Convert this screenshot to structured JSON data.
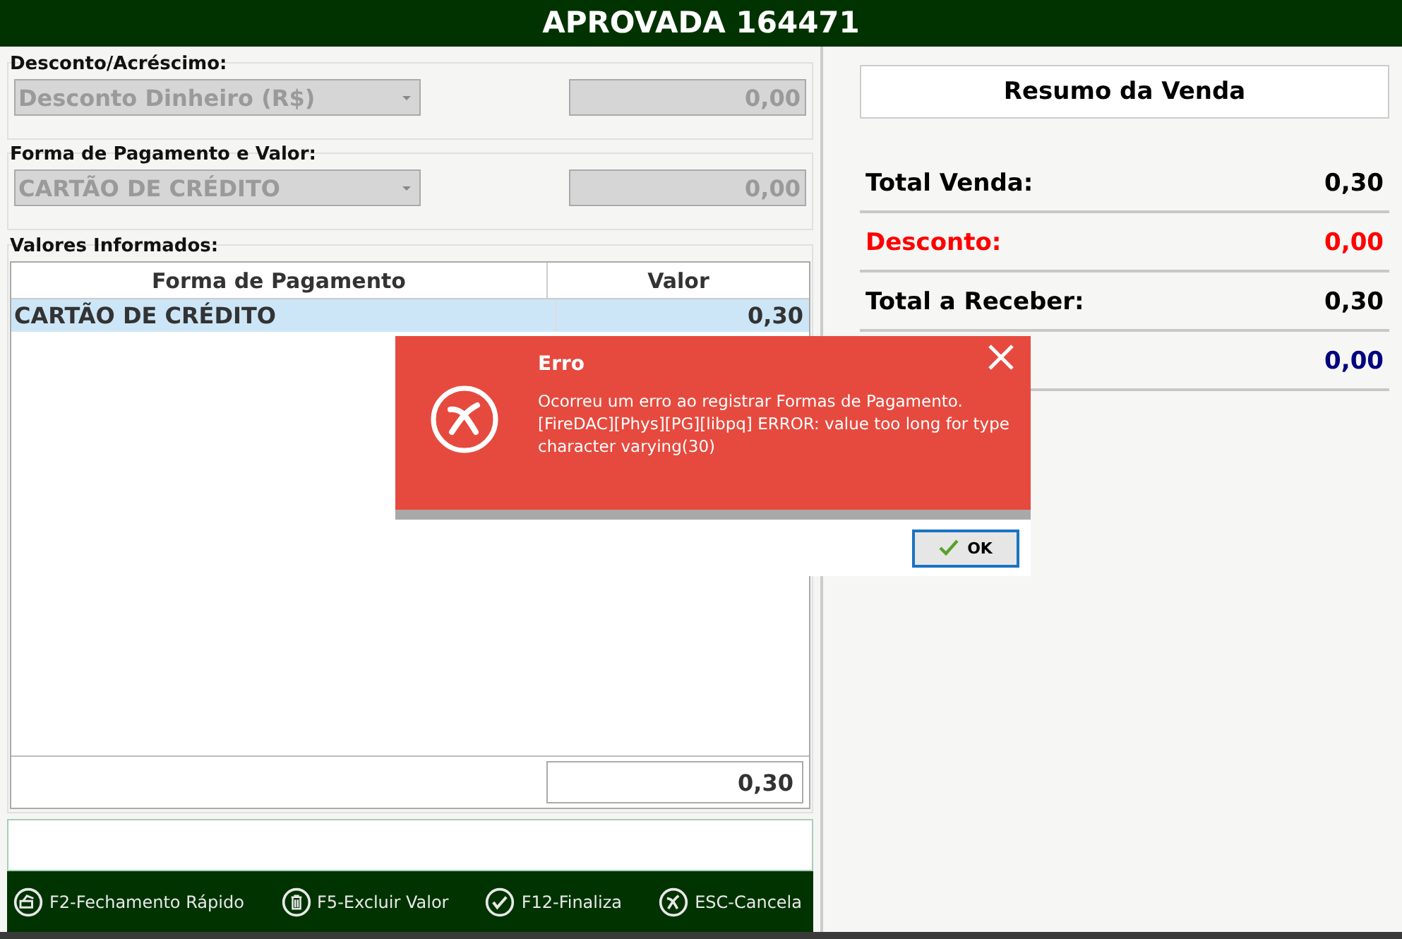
{
  "header": {
    "title": "APROVADA 164471"
  },
  "discount": {
    "legend": "Desconto/Acréscimo:",
    "select": {
      "value": "Desconto Dinheiro (R$)",
      "disabled": true
    },
    "amount": {
      "value": "0,00",
      "disabled": true
    }
  },
  "payment": {
    "legend": "Forma de Pagamento e Valor:",
    "select": {
      "value": "CARTÃO DE CRÉDITO",
      "disabled": true
    },
    "amount": {
      "value": "0,00",
      "disabled": true
    }
  },
  "values": {
    "legend": "Valores Informados:",
    "columns": [
      "Forma de Pagamento",
      "Valor"
    ],
    "rows": [
      {
        "cells": [
          "CARTÃO DE CRÉDITO",
          "0,30"
        ],
        "selected": true
      }
    ],
    "total": "0,30"
  },
  "footer_buttons": [
    {
      "label": "F2-Fechamento Rápido"
    },
    {
      "label": "F5-Excluir Valor"
    },
    {
      "label": "F12-Finaliza"
    },
    {
      "label": "ESC-Cancela"
    }
  ],
  "summary": {
    "title": "Resumo da Venda",
    "rows": [
      {
        "label": "Total Venda:",
        "value": "0,30",
        "color": "#000000"
      },
      {
        "label": "Desconto:",
        "value": "0,00",
        "color": "#ff0000"
      },
      {
        "label": "Total a Receber:",
        "value": "0,30",
        "color": "#000000"
      },
      {
        "value": "0,00",
        "color": "#000080"
      }
    ]
  },
  "dialog": {
    "title": "Erro",
    "message": "Ocorreu um erro ao registrar Formas de Pagamento. [FireDAC][Phys][PG][libpq] ERROR: value too long for type character varying(30)",
    "button": "OK"
  }
}
